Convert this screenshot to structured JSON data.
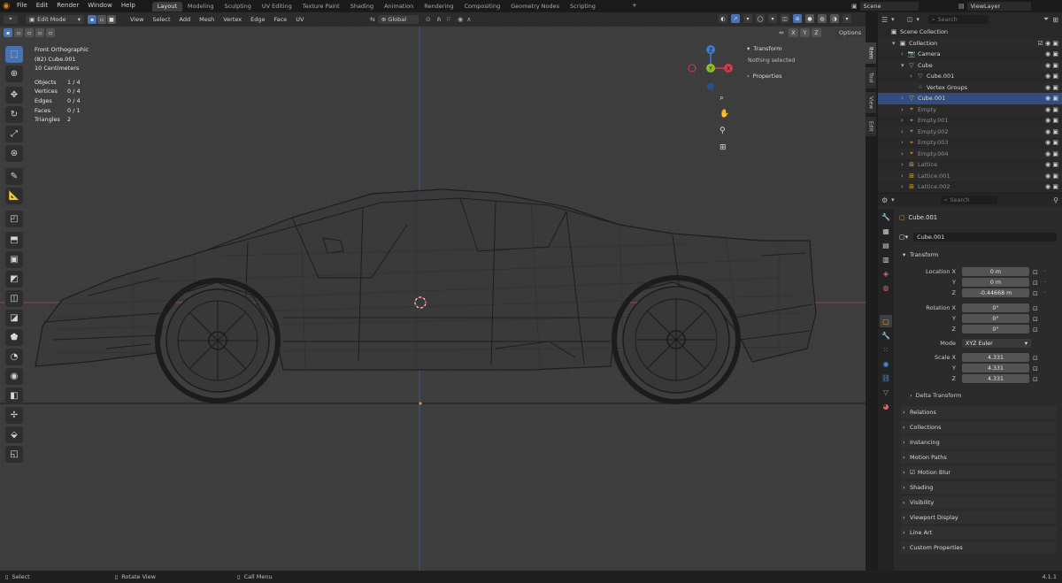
{
  "menu": [
    "File",
    "Edit",
    "Render",
    "Window",
    "Help"
  ],
  "workspaces": [
    "Layout",
    "Modeling",
    "Sculpting",
    "UV Editing",
    "Texture Paint",
    "Shading",
    "Animation",
    "Rendering",
    "Compositing",
    "Geometry Nodes",
    "Scripting"
  ],
  "active_workspace": "Layout",
  "scene": {
    "name": "Scene",
    "view_layer": "ViewLayer"
  },
  "viewport_header": {
    "mode": "Edit Mode",
    "menus": [
      "View",
      "Select",
      "Add",
      "Mesh",
      "Vertex",
      "Edge",
      "Face",
      "UV"
    ],
    "orientation": "Global",
    "axes": [
      "X",
      "Y",
      "Z"
    ],
    "options": "Options"
  },
  "overlay": {
    "view_name": "Front Orthographic",
    "object": "(82) Cube.001",
    "scale": "10 Centimeters",
    "stats": [
      {
        "label": "Objects",
        "value": "1 / 4"
      },
      {
        "label": "Vertices",
        "value": "0 / 4"
      },
      {
        "label": "Edges",
        "value": "0 / 4"
      },
      {
        "label": "Faces",
        "value": "0 / 1"
      },
      {
        "label": "Triangles",
        "value": "2"
      }
    ]
  },
  "gizmo": {
    "x": "X",
    "y": "Y",
    "z": "Z"
  },
  "npanel": {
    "transform": "Transform",
    "nothing": "Nothing selected",
    "properties": "Properties"
  },
  "side_tabs": [
    "Item",
    "Tool",
    "View",
    "Edit"
  ],
  "outliner": {
    "search_placeholder": "Search",
    "rows": [
      {
        "name": "Scene Collection",
        "indent": 0,
        "icon": "collection-icon",
        "dim": false,
        "selected": false
      },
      {
        "name": "Collection",
        "indent": 1,
        "icon": "collection-icon",
        "dim": false,
        "selected": false
      },
      {
        "name": "Camera",
        "indent": 2,
        "icon": "camera-icon",
        "dim": false,
        "selected": false
      },
      {
        "name": "Cube",
        "indent": 2,
        "icon": "mesh-icon",
        "dim": false,
        "selected": false
      },
      {
        "name": "Cube.001",
        "indent": 3,
        "icon": "mesh-data-icon",
        "dim": false,
        "selected": false
      },
      {
        "name": "Vertex Groups",
        "indent": 3,
        "icon": "vertex-groups-icon",
        "dim": false,
        "selected": false
      },
      {
        "name": "Cube.001",
        "indent": 2,
        "icon": "mesh-icon",
        "dim": false,
        "selected": true
      },
      {
        "name": "Empty",
        "indent": 2,
        "icon": "empty-icon",
        "dim": true,
        "selected": false
      },
      {
        "name": "Empty.001",
        "indent": 2,
        "icon": "empty-icon",
        "dim": true,
        "selected": false
      },
      {
        "name": "Empty.002",
        "indent": 2,
        "icon": "empty-icon",
        "dim": true,
        "selected": false
      },
      {
        "name": "Empty.003",
        "indent": 2,
        "icon": "empty-icon",
        "dim": true,
        "selected": false
      },
      {
        "name": "Empty.004",
        "indent": 2,
        "icon": "empty-icon",
        "dim": true,
        "selected": false
      },
      {
        "name": "Lattice",
        "indent": 2,
        "icon": "lattice-icon",
        "dim": true,
        "selected": false
      },
      {
        "name": "Lattice.001",
        "indent": 2,
        "icon": "lattice-icon",
        "dim": true,
        "selected": false
      },
      {
        "name": "Lattice.002",
        "indent": 2,
        "icon": "lattice-icon",
        "dim": true,
        "selected": false
      }
    ]
  },
  "properties": {
    "search_placeholder": "Search",
    "object_name": "Cube.001",
    "data_name": "Cube.001",
    "transform_label": "Transform",
    "location": {
      "label": "Location X",
      "x": "0 m",
      "y": "0 m",
      "z": "-0.44668 m"
    },
    "rotation": {
      "label": "Rotation X",
      "x": "0°",
      "y": "0°",
      "z": "0°"
    },
    "mode": {
      "label": "Mode",
      "value": "XYZ Euler"
    },
    "scale": {
      "label": "Scale X",
      "x": "4.331",
      "y": "4.331",
      "z": "4.331"
    },
    "axis_y": "Y",
    "axis_z": "Z",
    "delta": "Delta Transform",
    "sections": [
      "Relations",
      "Collections",
      "Instancing",
      "Motion Paths",
      "Motion Blur",
      "Shading",
      "Visibility",
      "Viewport Display",
      "Line Art",
      "Custom Properties"
    ]
  },
  "status": {
    "select": "Select",
    "rotate": "Rotate View",
    "menu": "Call Menu",
    "version": "4.1.1"
  },
  "colors": {
    "accent": "#4772b3",
    "selection_row": "#334d80",
    "x_axis": "#d63b4a",
    "y_axis": "#8fbb25",
    "z_axis": "#3b7ad6",
    "orange": "#e87d0d"
  }
}
